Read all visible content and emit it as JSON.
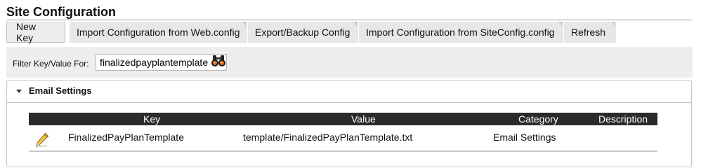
{
  "page": {
    "title": "Site Configuration"
  },
  "toolbar": {
    "buttons": [
      {
        "label": "New Key"
      },
      {
        "label": "Import Configuration from Web.config"
      },
      {
        "label": "Export/Backup Config"
      },
      {
        "label": "Import Configuration from SiteConfig.config"
      },
      {
        "label": "Refresh"
      }
    ]
  },
  "filter": {
    "label": "Filter Key/Value For:",
    "value": "finalizedpayplantemplate",
    "search_icon": "binoculars-icon"
  },
  "panel": {
    "title": "Email Settings",
    "expanded": true,
    "table": {
      "columns": [
        "Key",
        "Value",
        "Category",
        "Description"
      ],
      "rows": [
        {
          "edit_icon": "pencil-icon",
          "key": "FinalizedPayPlanTemplate",
          "value": "template/FinalizedPayPlanTemplate.txt",
          "category": "Email Settings",
          "description": ""
        }
      ]
    }
  },
  "colors": {
    "header_bg": "#2b2b2b",
    "toolbar_bg": "#e7e7e7",
    "filter_bg": "#eeeeee"
  }
}
